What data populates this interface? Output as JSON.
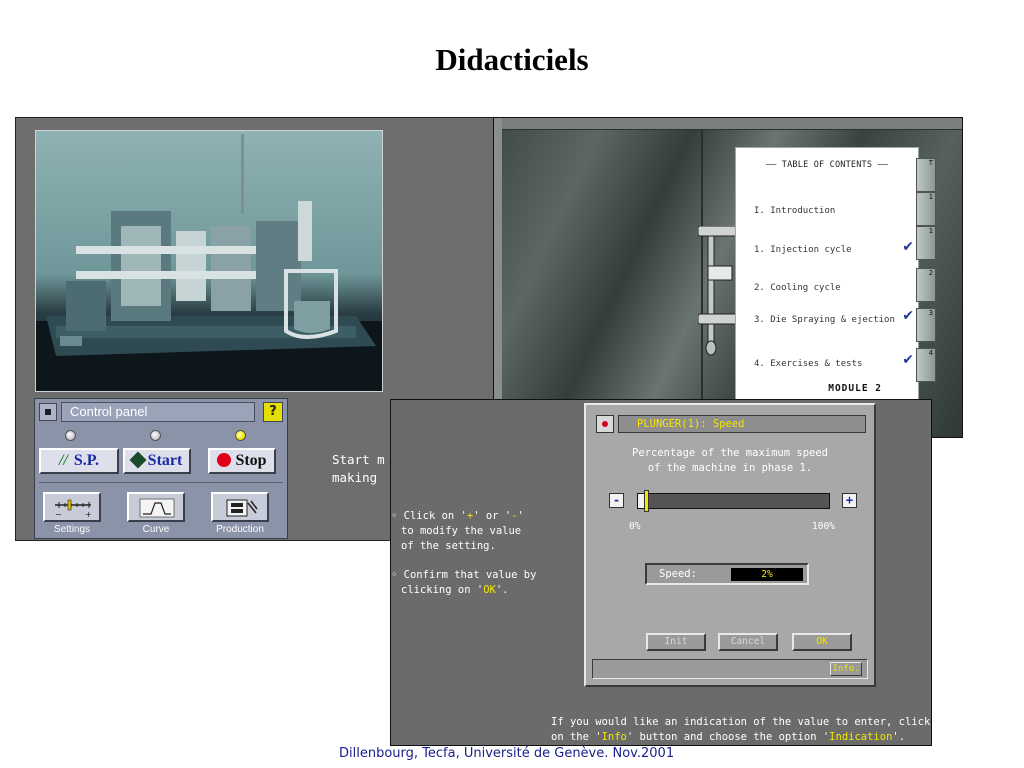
{
  "slide": {
    "title": "Didacticiels",
    "footer": "Dillenbourg, Tecfa, Université de Genève. Nov.2001"
  },
  "simulator": {
    "control_panel": {
      "title": "Control panel",
      "help_label": "?",
      "buttons": {
        "sp": "S.P.",
        "sp_glyph": "//",
        "start": "Start",
        "stop": "Stop"
      },
      "tools": [
        {
          "label": "Settings",
          "icon": "settings-scale-icon"
        },
        {
          "label": "Curve",
          "icon": "curve-icon"
        },
        {
          "label": "Production",
          "icon": "production-icon"
        }
      ],
      "lamp_active": "stop"
    },
    "side_text": "Start m\nmaking"
  },
  "toc": {
    "heading": "TABLE OF CONTENTS",
    "items": [
      {
        "label": "I. Introduction",
        "checked": false
      },
      {
        "label": "1. Injection cycle",
        "checked": true
      },
      {
        "label": "2. Cooling cycle",
        "checked": false
      },
      {
        "label": "3. Die Spraying & ejection",
        "checked": true
      },
      {
        "label": "4. Exercises & tests",
        "checked": true
      }
    ],
    "check_glyph": "✔",
    "module": "MODULE 2",
    "tabs": [
      "T",
      "1",
      "1",
      "2",
      "3",
      "4"
    ]
  },
  "plunger": {
    "instructions": {
      "line1_pre": "Click on '",
      "plus": "+",
      "line1_mid": "' or '",
      "minus": "-",
      "line1_post": "'",
      "line2": "to modify the value",
      "line3": "of the setting.",
      "line4": "Confirm that value by",
      "line5_pre": "clicking on '",
      "ok": "OK",
      "line5_post": "'."
    },
    "bottom_help": {
      "line1": "If you would like an indication of the value to enter, click",
      "line2_pre": "on the '",
      "info": "Info",
      "line2_mid": "' button and choose the option '",
      "indication": "Indication",
      "line2_post": "'."
    },
    "dialog": {
      "title": "PLUNGER(1): Speed",
      "description": "Percentage of the maximum speed\nof the machine in phase 1.",
      "minus_label": "-",
      "plus_label": "+",
      "scale_min": "0%",
      "scale_max": "100%",
      "slider_value": 2,
      "speed_label": "Speed:",
      "speed_value": "2%",
      "init_label": "Init",
      "cancel_label": "Cancel",
      "ok_label": "OK",
      "info_label": "Info."
    }
  },
  "colors": {
    "highlight": "#f5e600",
    "stop_red": "#e0001c",
    "panel_blue": "#8a93a8"
  }
}
